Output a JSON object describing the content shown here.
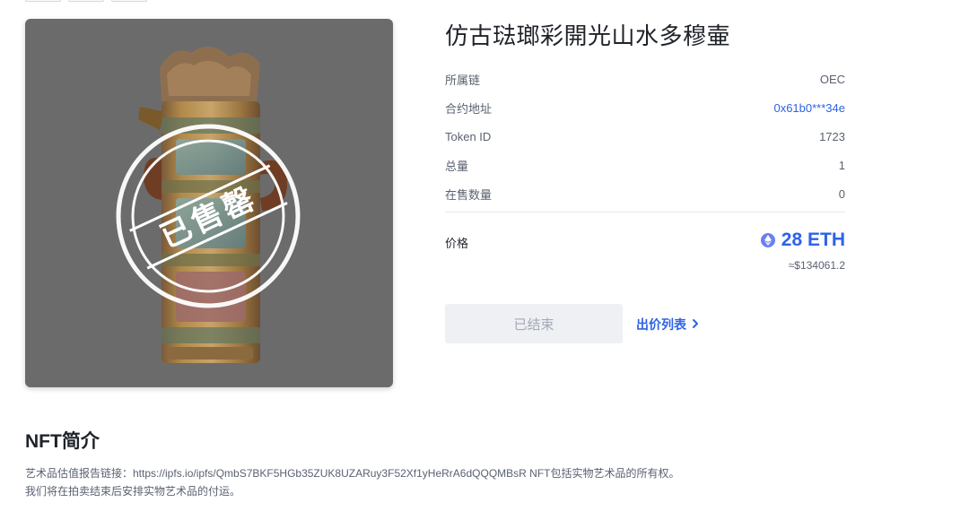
{
  "title": "仿古琺瑯彩開光山水多穆壷",
  "artwork": {
    "sold_stamp": "已售罄"
  },
  "info": [
    {
      "label": "所属链",
      "value": "OEC",
      "is_link": false
    },
    {
      "label": "合约地址",
      "value": "0x61b0***34e",
      "is_link": true
    },
    {
      "label": "Token ID",
      "value": "1723",
      "is_link": false
    },
    {
      "label": "总量",
      "value": "1",
      "is_link": false
    },
    {
      "label": "在售数量",
      "value": "0",
      "is_link": false
    }
  ],
  "price": {
    "label": "价格",
    "amount": "28 ETH",
    "usd": "≈$134061.2",
    "icon": "ethereum-icon"
  },
  "actions": {
    "ended_label": "已结束",
    "bid_list_label": "出价列表"
  },
  "intro": {
    "title": "NFT简介",
    "line1": "艺术品估值报告链接：https://ipfs.io/ipfs/QmbS7BKF5HGb35ZUK8UZARuy3F52Xf1yHeRrA6dQQQMBsR NFT包括实物艺术品的所有权。",
    "line2": "我们将在拍卖结束后安排实物艺术品的付运。"
  },
  "colors": {
    "accent": "#2d63e6",
    "text": "#1f2329",
    "muted": "#5a6170",
    "button_disabled_bg": "#eef0f4"
  }
}
